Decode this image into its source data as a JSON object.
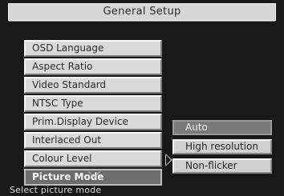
{
  "header": {
    "title": "General Setup"
  },
  "menu": {
    "items": [
      {
        "label": "OSD Language"
      },
      {
        "label": "Aspect Ratio"
      },
      {
        "label": "Video Standard"
      },
      {
        "label": "NTSC Type"
      },
      {
        "label": "Prim.Display Device"
      },
      {
        "label": "Interlaced Out"
      },
      {
        "label": "Colour Level"
      },
      {
        "label": "Picture Mode"
      }
    ],
    "selected_index": 7,
    "more_below_icon": "chevron-down-icon"
  },
  "submenu": {
    "items": [
      {
        "label": "Auto"
      },
      {
        "label": "High resolution"
      },
      {
        "label": "Non-flicker"
      }
    ],
    "selected_index": 0,
    "pointer_icon": "triangle-right-icon"
  },
  "status": {
    "text": "Select picture mode"
  }
}
